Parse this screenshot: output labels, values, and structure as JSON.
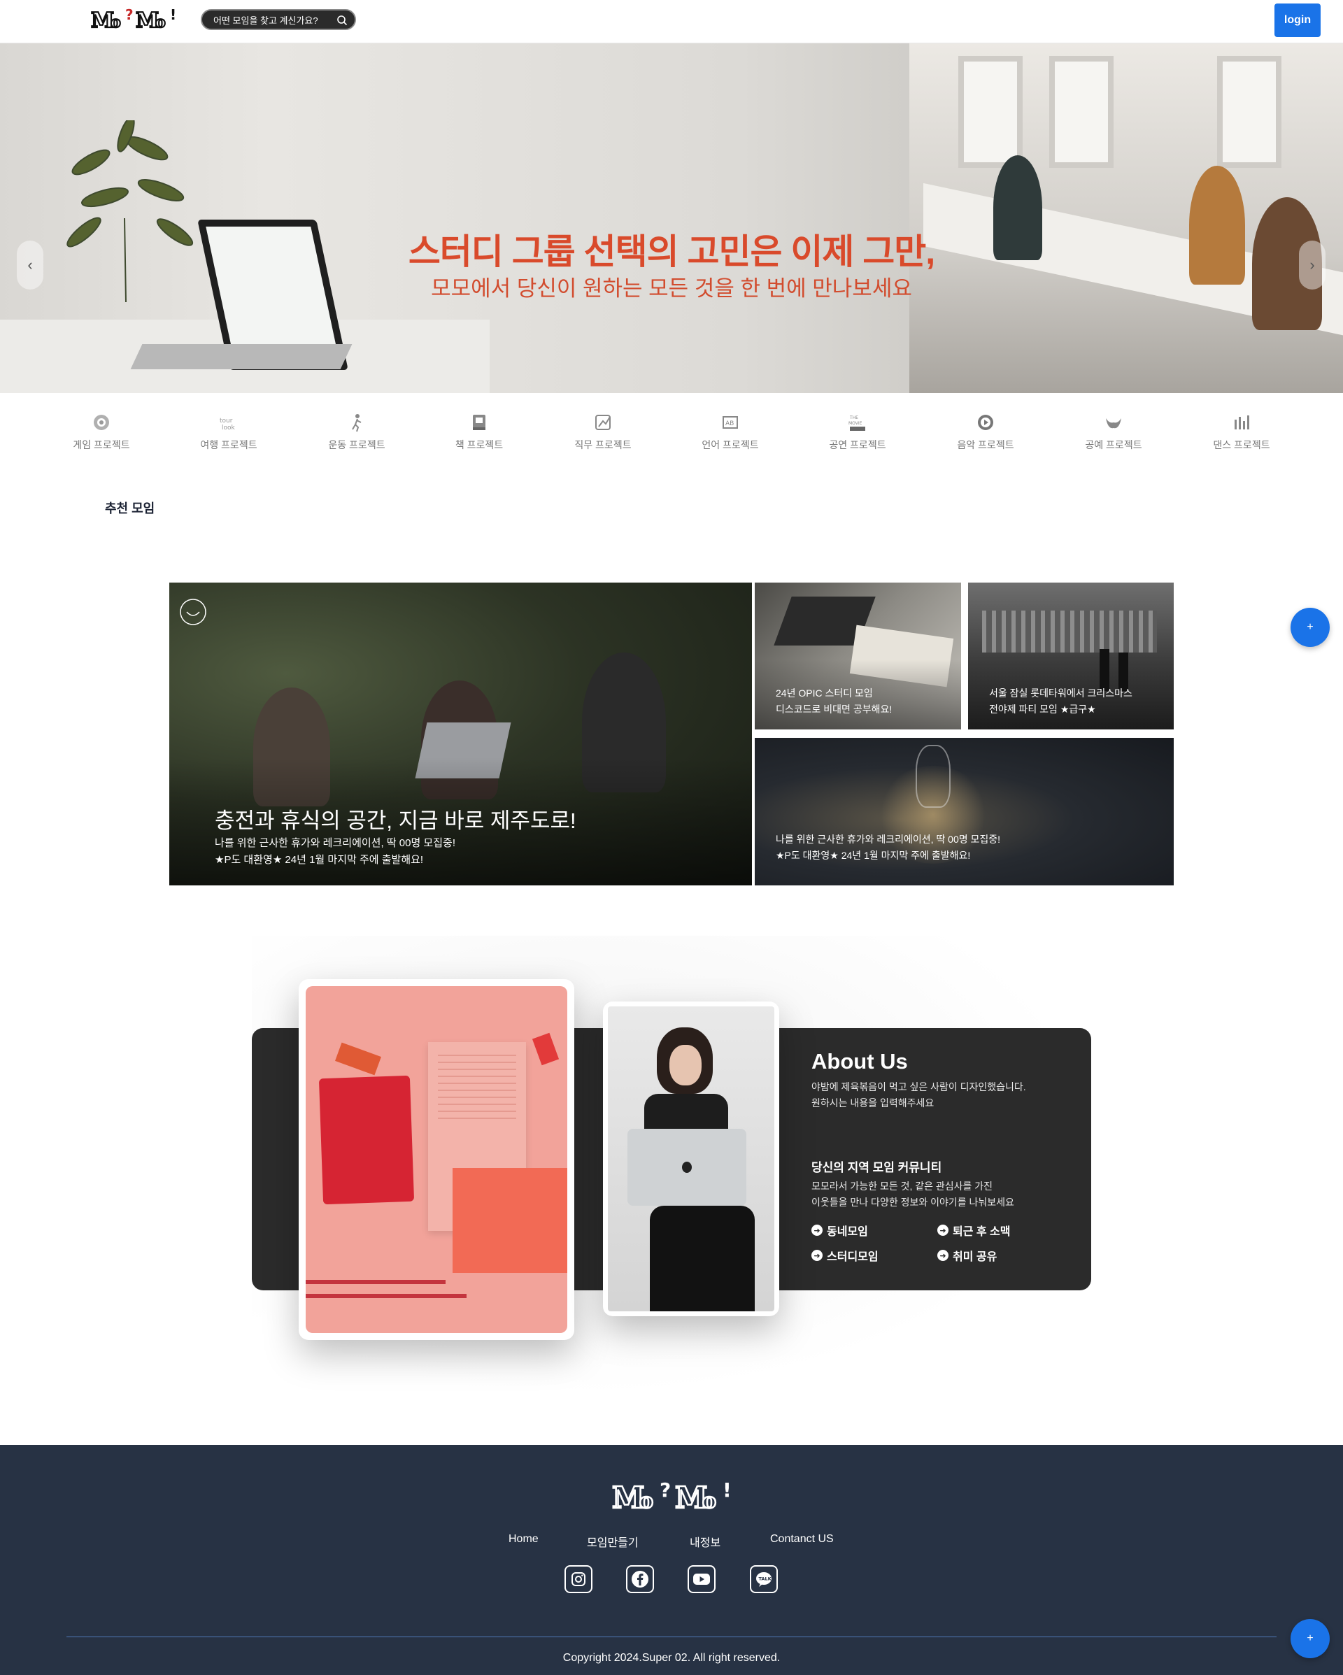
{
  "header": {
    "logo_text": "Mo?Mo!",
    "search_placeholder": "어떤 모임을 찾고 계신가요?",
    "login_label": "login"
  },
  "hero": {
    "title": "스터디 그룹 선택의 고민은 이제 그만,",
    "subtitle": "모모에서 당신이 원하는 모든 것을 한 번에 만나보세요",
    "prev_icon": "chevron-left-icon",
    "next_icon": "chevron-right-icon",
    "slide_count": 10,
    "active_slide": 2
  },
  "categories": [
    {
      "label": "게임 프로젝트",
      "icon": "game-icon"
    },
    {
      "label": "여행 프로젝트",
      "icon": "travel-icon"
    },
    {
      "label": "운동 프로젝트",
      "icon": "exercise-icon"
    },
    {
      "label": "책 프로젝트",
      "icon": "book-icon"
    },
    {
      "label": "직무 프로젝트",
      "icon": "job-icon"
    },
    {
      "label": "언어 프로젝트",
      "icon": "language-icon"
    },
    {
      "label": "공연 프로젝트",
      "icon": "performance-icon"
    },
    {
      "label": "음악 프로젝트",
      "icon": "music-icon"
    },
    {
      "label": "공예 프로젝트",
      "icon": "craft-icon"
    },
    {
      "label": "댄스 프로젝트",
      "icon": "dance-icon"
    }
  ],
  "recommended": {
    "section_title": "추천 모임",
    "main_card": {
      "title": "충전과 휴식의 공간, 지금 바로 제주도로!",
      "line1": "나를 위한 근사한 휴가와 레크리에이션, 딱 00명 모집중!",
      "line2": "★P도 대환영★ 24년 1월 마지막 주에 출발해요!"
    },
    "card_opic": {
      "line1": "24년 OPIC 스터디 모임",
      "line2": "디스코드로 비대면 공부해요!"
    },
    "card_lotte": {
      "line1": "서울 잠실 롯데타워에서 크리스마스",
      "line2": "전야제 파티 모임 ★급구★"
    },
    "card_bulb": {
      "line1": "나를 위한 근사한 휴가와 레크리에이션, 딱 00명 모집중!",
      "line2": "★P도 대환영★ 24년 1월 마지막 주에 출발해요!"
    },
    "fab_label": "+"
  },
  "about": {
    "title": "About Us",
    "desc1": "야밤에 제육볶음이 먹고 싶은 사람이 디자인했습니다.",
    "desc2": "원하시는 내용을 입력해주세요",
    "heading": "당신의 지역 모임 커뮤니티",
    "body1": "모모라서 가능한 모든 것, 같은 관심사를 가진",
    "body2": "이웃들을 만나 다양한 정보와 이야기를 나눠보세요",
    "links": [
      "동네모임",
      "퇴근 후 소맥",
      "스터디모임",
      "취미 공유"
    ]
  },
  "footer": {
    "logo_text": "Mo?Mo!",
    "nav": [
      "Home",
      "모임만들기",
      "내정보",
      "Contanct US"
    ],
    "social": [
      "instagram-icon",
      "facebook-icon",
      "youtube-icon",
      "kakaotalk-icon"
    ],
    "copyright": "Copyright 2024.Super 02. All right reserved.",
    "fab_label": "+"
  },
  "colors": {
    "accent": "#1a73e8",
    "hero_text": "#d94a2b",
    "about_band": "#2b2b2b",
    "footer_bg": "#273244"
  }
}
